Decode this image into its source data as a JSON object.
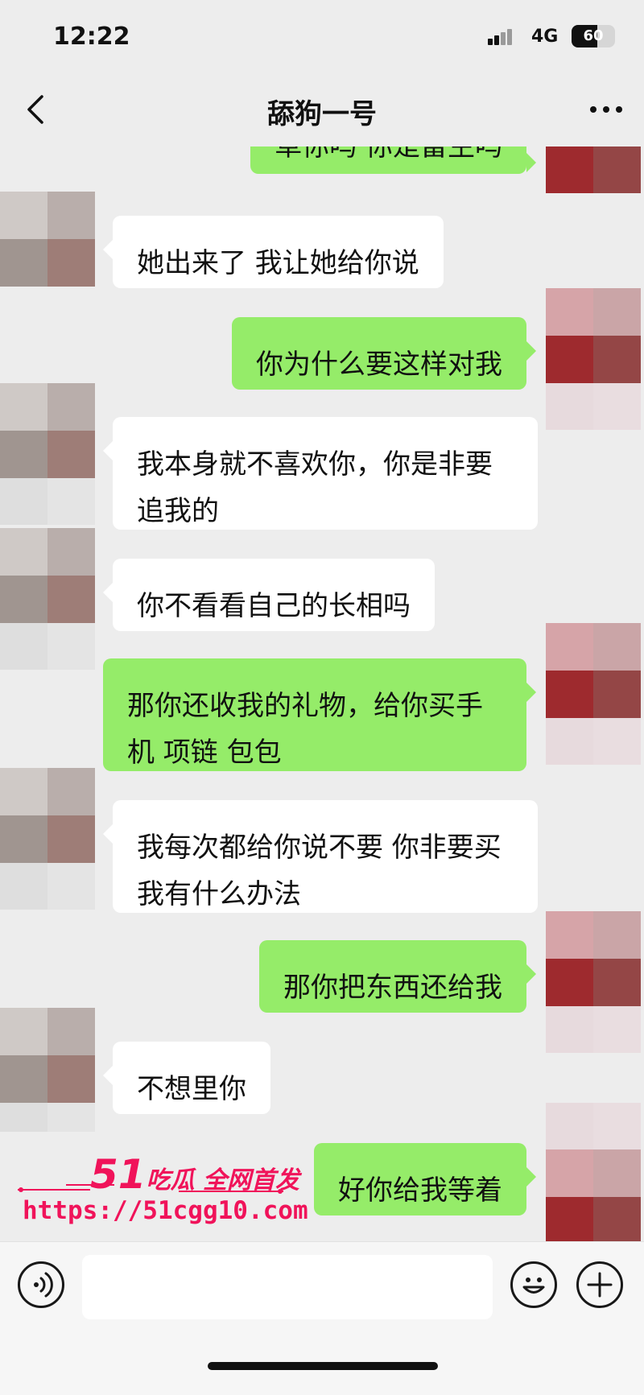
{
  "status_bar": {
    "time": "12:22",
    "network": "4G",
    "battery": "60"
  },
  "header": {
    "title": "舔狗一号",
    "back_icon": "back-arrow-icon",
    "more_icon": "more-dots-icon"
  },
  "messages": [
    {
      "side": "out",
      "text": "草你吗 你是畜生吗"
    },
    {
      "side": "in",
      "text": "她出来了 我让她给你说"
    },
    {
      "side": "out",
      "text": "你为什么要这样对我"
    },
    {
      "side": "in",
      "text": "我本身就不喜欢你，你是非要\n追我的"
    },
    {
      "side": "in",
      "text": "你不看看自己的长相吗"
    },
    {
      "side": "out",
      "text": "那你还收我的礼物，给你买手\n机 项链 包包"
    },
    {
      "side": "in",
      "text": "我每次都给你说不要 你非要买\n我有什么办法"
    },
    {
      "side": "out",
      "text": "那你把东西还给我"
    },
    {
      "side": "in",
      "text": "不想里你"
    },
    {
      "side": "out",
      "text": "好你给我等着"
    }
  ],
  "watermark": {
    "brand_num": "51",
    "brand_rest": "吃瓜 全网首发",
    "url": "https://51cgg10.com",
    "color": "#f0135a"
  },
  "input_bar": {
    "voice_icon": "voice-icon",
    "emoji_icon": "emoji-icon",
    "plus_icon": "plus-icon",
    "value": ""
  },
  "colors": {
    "outgoing_bubble": "#95ec69",
    "incoming_bubble": "#ffffff",
    "background": "#ededed"
  }
}
